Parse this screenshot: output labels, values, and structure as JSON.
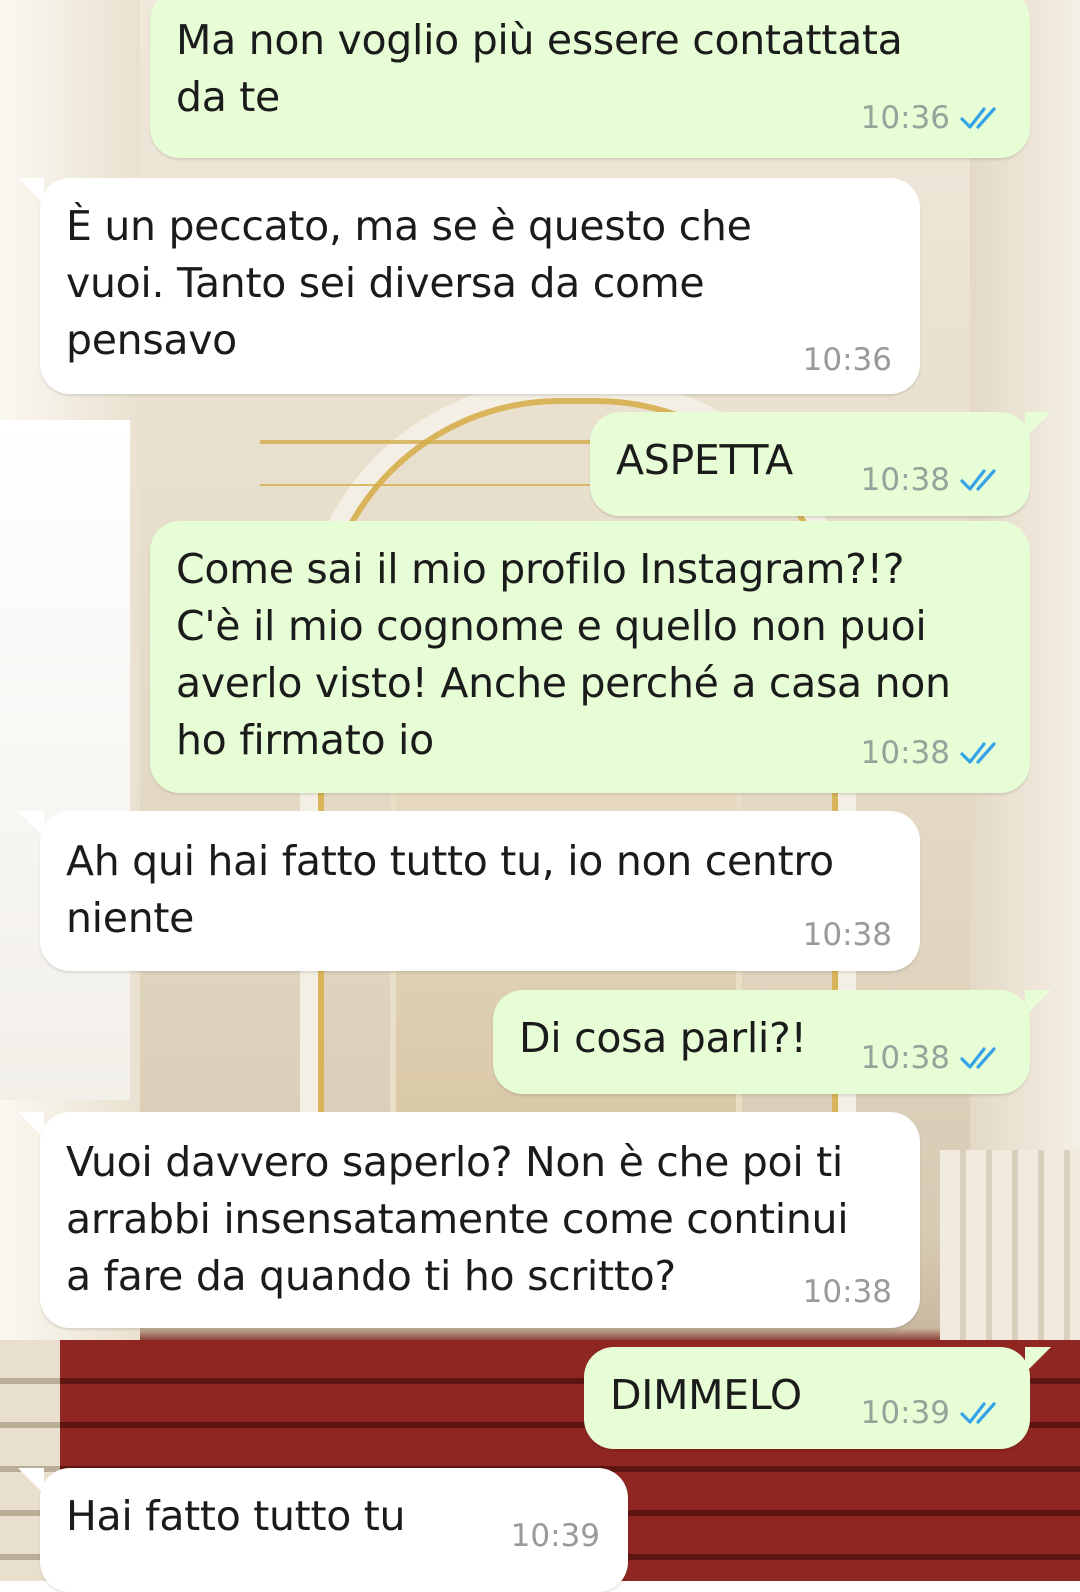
{
  "wallpaper": {
    "description_icon": "palace-staircase-wallpaper"
  },
  "colors": {
    "outgoing_bubble": "#e7fdd6",
    "incoming_bubble": "#ffffff",
    "read_ticks": "#34a3e8",
    "timestamp": "#97a39a"
  },
  "messages": [
    {
      "direction": "out",
      "text": "Ma non voglio più essere contattata\nda te",
      "time": "10:36",
      "status": "read"
    },
    {
      "direction": "in",
      "text": "È un peccato, ma se è questo che\nvuoi. Tanto sei diversa da come\npensavo",
      "time": "10:36"
    },
    {
      "direction": "out",
      "text": "ASPETTA",
      "time": "10:38",
      "status": "read"
    },
    {
      "direction": "out",
      "text": "Come sai il mio profilo Instagram?!?\nC'è il mio cognome e quello non puoi\naverlo visto! Anche perché a casa non\nho firmato io",
      "time": "10:38",
      "status": "read"
    },
    {
      "direction": "in",
      "text": "Ah qui hai fatto tutto tu, io non centro\nniente",
      "time": "10:38"
    },
    {
      "direction": "out",
      "text": "Di cosa parli?!",
      "time": "10:38",
      "status": "read"
    },
    {
      "direction": "in",
      "text": "Vuoi davvero saperlo? Non è che poi ti\narrabbi insensatamente come continui\na fare da quando ti ho scritto?",
      "time": "10:38"
    },
    {
      "direction": "out",
      "text": "DIMMELO",
      "time": "10:39",
      "status": "read"
    },
    {
      "direction": "in",
      "text": "Hai fatto tutto tu",
      "time": "10:39"
    }
  ]
}
